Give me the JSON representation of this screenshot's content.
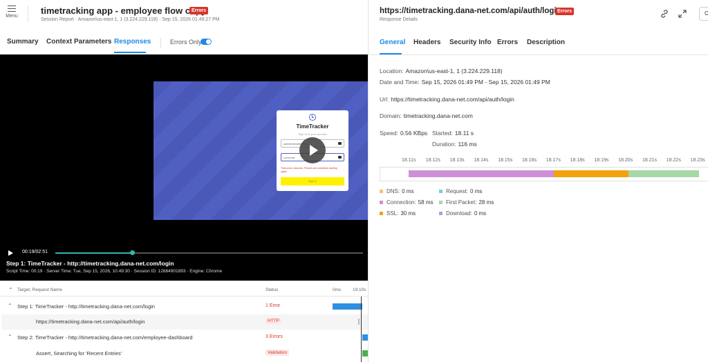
{
  "left": {
    "menu_label": "Menu",
    "title": "timetracking app - employee flow copy",
    "title_badge": "Errors",
    "subtitle": "Session Report · Amazon\\us-east-1, 1 (3.224.229.118) · Sep 15, 2026 01:49:27 PM",
    "tabs": [
      "Summary",
      "Context Parameters",
      "Responses"
    ],
    "active_tab": "Responses",
    "errors_only_label": "Errors Only",
    "errors_only_on": true,
    "video": {
      "card_title": "TimeTracker",
      "card_subtitle": "Sign in to your account",
      "email_value": "curent.bloomb@tm...",
      "password_value": "••••••••••d",
      "error_text": "Thecourse ofaccess. Please and ordentials starting again.",
      "button_text": "Sign in",
      "time": "00:19/02:51",
      "progress_fraction": 0.25,
      "step_title": "Step 1: TimeTracker - http://timetracking.dana-net.com/login",
      "step_meta": "Script Time: 00:19  ·  Server Time: Tue, Sep 15, 2026, 10:49:30  ·  Session ID: 12884901893  ·  Engine: Chrome"
    },
    "table": {
      "headers": [
        "Target, Request Name",
        "Status",
        "0ms",
        "19.10s"
      ],
      "rows": [
        {
          "caret": "^",
          "name": "Step 1: TimeTracker - http://timetracking.dana-net.com/login",
          "status": "1 Error",
          "status_type": "text",
          "indent": false
        },
        {
          "caret": "",
          "name": "https://timetracking.dana-net.com/api/auth/login",
          "status": "HTTP",
          "status_type": "pill",
          "indent": true
        },
        {
          "caret": "^",
          "name": "Step 2: TimeTracker - http://timetracking.dana-net.com/employee-dashboard",
          "status": "3 Errors",
          "status_type": "text",
          "indent": false
        },
        {
          "caret": "",
          "name": "Assert, Searching for 'Recent Entries'",
          "status": "Validation",
          "status_type": "pill",
          "indent": true
        }
      ]
    }
  },
  "right": {
    "url_title": "https://timetracking.dana-net.com/api/auth/login",
    "url_badge": "Errors",
    "subtitle": "Response Details",
    "close_chip": "C",
    "tabs": [
      "General",
      "Headers",
      "Security Info",
      "Errors",
      "Description"
    ],
    "active_tab": "General",
    "general": {
      "location_label": "Location:",
      "location_value": "Amazon\\us-east-1, 1 (3.224.229.118)",
      "datetime_label": "Date and Time:",
      "datetime_value": "Sep 15, 2026 01:49 PM - Sep 15, 2026 01:49 PM",
      "url_label": "Url:",
      "url_value": "https://timetracking.dana-net.com/api/auth/login",
      "domain_label": "Domain:",
      "domain_value": "timetracking.dana-net.com",
      "speed_label": "Speed:",
      "speed_value": "0.56 KBps",
      "started_label": "Started:",
      "started_value": "18.11 s",
      "duration_label": "Duration:",
      "duration_value": "116 ms"
    },
    "timeline": {
      "ticks": [
        "18.11s",
        "18.12s",
        "18.13s",
        "18.14s",
        "18.15s",
        "18.16s",
        "18.17s",
        "18.18s",
        "18.19s",
        "18.20s",
        "18.21s",
        "18.22s",
        "18.23s"
      ],
      "legend": [
        {
          "label": "DNS:",
          "value": "0 ms",
          "color": "#f5c26b"
        },
        {
          "label": "Request:",
          "value": "0 ms",
          "color": "#6fd3d8"
        },
        {
          "label": "Connection:",
          "value": "58 ms",
          "color": "#cf8fd8"
        },
        {
          "label": "First Packet:",
          "value": "28 ms",
          "color": "#a6d8a8"
        },
        {
          "label": "SSL:",
          "value": "30 ms",
          "color": "#f2a20c"
        },
        {
          "label": "Download:",
          "value": "0 ms",
          "color": "#b39ddb"
        }
      ]
    }
  }
}
